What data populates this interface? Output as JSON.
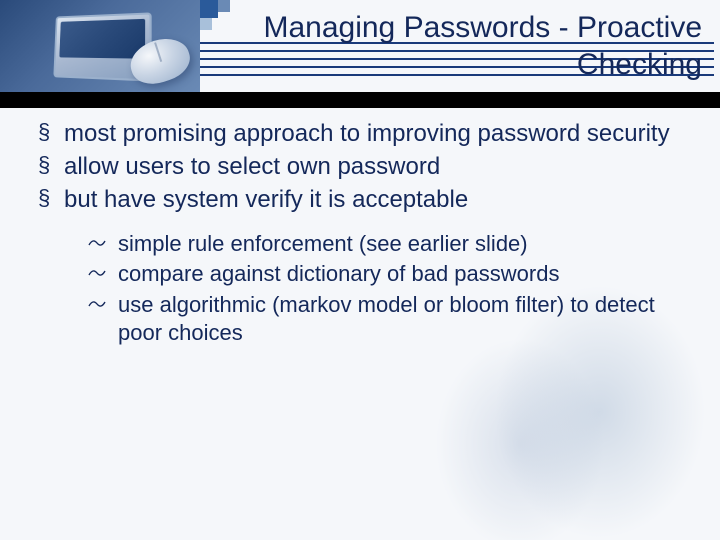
{
  "slide": {
    "title": "Managing Passwords - Proactive Checking",
    "bullets": [
      "most promising approach to improving password security",
      "allow users to select own password",
      "but have system verify it is acceptable"
    ],
    "sub_bullets": [
      "simple rule enforcement (see earlier slide)",
      "compare against dictionary of bad passwords",
      "use algorithmic (markov model or bloom filter) to detect poor choices"
    ]
  }
}
